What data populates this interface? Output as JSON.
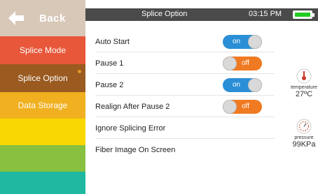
{
  "back": {
    "label": "Back"
  },
  "nav": [
    {
      "label": "Splice Mode",
      "color": "#e8573a"
    },
    {
      "label": "Splice Option",
      "color": "#9a5a20",
      "active": true
    },
    {
      "label": "Data Storage",
      "color": "#f0b020"
    },
    {
      "label": "",
      "color": "#f8d800"
    },
    {
      "label": "",
      "color": "#88c040"
    },
    {
      "label": "",
      "color": "#20b8a0"
    }
  ],
  "header": {
    "title": "Splice Option",
    "time": "03:15 PM"
  },
  "settings": [
    {
      "label": "Auto Start",
      "toggle": "on"
    },
    {
      "label": "Pause 1",
      "toggle": "off"
    },
    {
      "label": "Pause 2",
      "toggle": "on"
    },
    {
      "label": "Realign After Pause 2",
      "toggle": "off"
    },
    {
      "label": "Ignore Splicing Error"
    },
    {
      "label": "Fiber Image On Screen"
    }
  ],
  "sensors": {
    "temperature": {
      "label": "temperature",
      "value": "27ºC"
    },
    "pressure": {
      "label": "pressure",
      "value": "99KPa"
    }
  },
  "colors": {
    "accent_on": "#2a8fd6",
    "accent_off": "#f07a22",
    "battery": "#22cc22"
  }
}
